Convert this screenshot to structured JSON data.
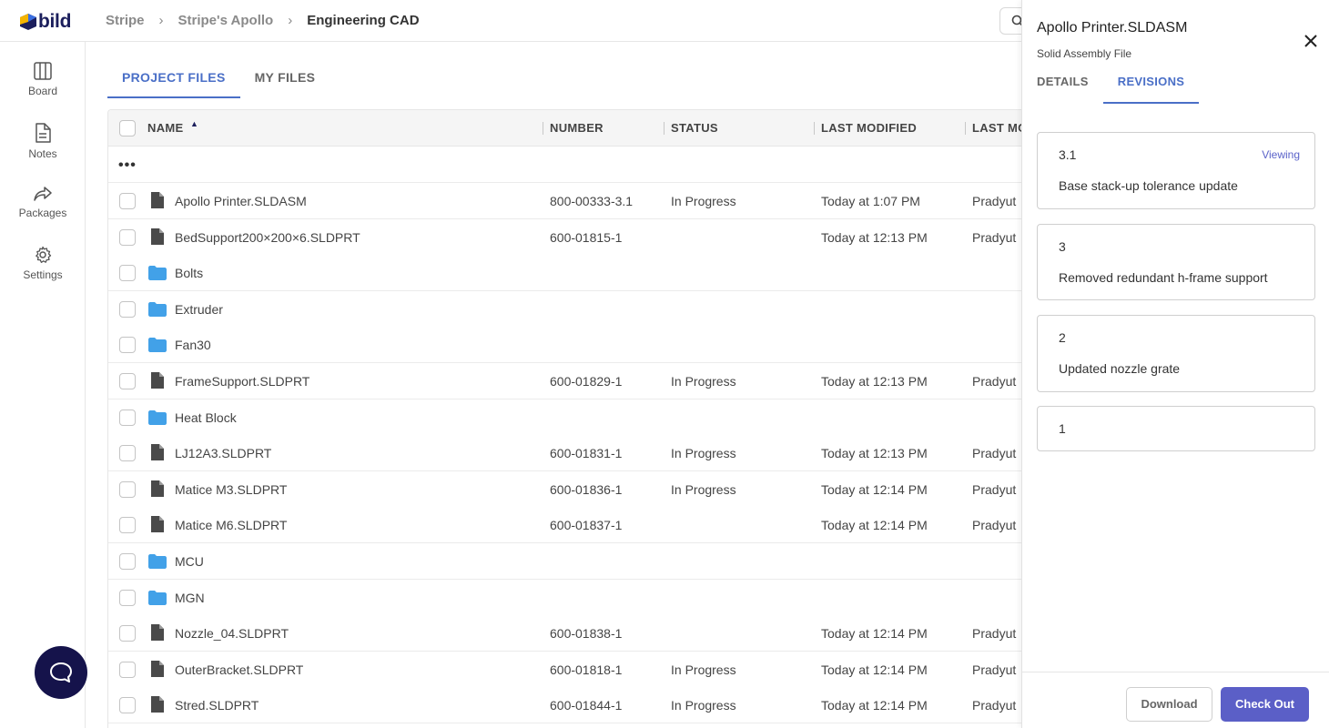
{
  "app": {
    "logo_text": "bild"
  },
  "breadcrumb": [
    "Stripe",
    "Stripe's Apollo",
    "Engineering CAD"
  ],
  "sidebar": {
    "items": [
      {
        "label": "Board",
        "icon": "board-icon"
      },
      {
        "label": "Notes",
        "icon": "notes-icon"
      },
      {
        "label": "Packages",
        "icon": "share-arrow-icon"
      },
      {
        "label": "Settings",
        "icon": "gear-icon"
      }
    ]
  },
  "main": {
    "tabs": [
      {
        "label": "PROJECT FILES",
        "active": true
      },
      {
        "label": "MY FILES",
        "active": false
      }
    ],
    "table": {
      "columns": [
        "NAME",
        "NUMBER",
        "STATUS",
        "LAST MODIFIED",
        "LAST MO"
      ],
      "sort_indicator": "▲",
      "parent_dir": "•••",
      "rows": [
        {
          "type": "file",
          "name": "Apollo Printer.SLDASM",
          "number": "800-00333-3.1",
          "status": "In Progress",
          "modified": "Today at 1:07 PM",
          "modified_by": "Pradyut"
        },
        {
          "type": "file",
          "name": "BedSupport200×200×6.SLDPRT",
          "number": "600-01815-1",
          "status": "",
          "modified": "Today at 12:13 PM",
          "modified_by": "Pradyut"
        },
        {
          "type": "folder",
          "name": "Bolts",
          "number": "",
          "status": "",
          "modified": "",
          "modified_by": ""
        },
        {
          "type": "folder",
          "name": "Extruder",
          "number": "",
          "status": "",
          "modified": "",
          "modified_by": ""
        },
        {
          "type": "folder",
          "name": "Fan30",
          "number": "",
          "status": "",
          "modified": "",
          "modified_by": ""
        },
        {
          "type": "file",
          "name": "FrameSupport.SLDPRT",
          "number": "600-01829-1",
          "status": "In Progress",
          "modified": "Today at 12:13 PM",
          "modified_by": "Pradyut"
        },
        {
          "type": "folder",
          "name": "Heat Block",
          "number": "",
          "status": "",
          "modified": "",
          "modified_by": ""
        },
        {
          "type": "file",
          "name": "LJ12A3.SLDPRT",
          "number": "600-01831-1",
          "status": "In Progress",
          "modified": "Today at 12:13 PM",
          "modified_by": "Pradyut"
        },
        {
          "type": "file",
          "name": "Matice M3.SLDPRT",
          "number": "600-01836-1",
          "status": "In Progress",
          "modified": "Today at 12:14 PM",
          "modified_by": "Pradyut"
        },
        {
          "type": "file",
          "name": "Matice M6.SLDPRT",
          "number": "600-01837-1",
          "status": "",
          "modified": "Today at 12:14 PM",
          "modified_by": "Pradyut"
        },
        {
          "type": "folder",
          "name": "MCU",
          "number": "",
          "status": "",
          "modified": "",
          "modified_by": ""
        },
        {
          "type": "folder",
          "name": "MGN",
          "number": "",
          "status": "",
          "modified": "",
          "modified_by": ""
        },
        {
          "type": "file",
          "name": "Nozzle_04.SLDPRT",
          "number": "600-01838-1",
          "status": "",
          "modified": "Today at 12:14 PM",
          "modified_by": "Pradyut"
        },
        {
          "type": "file",
          "name": "OuterBracket.SLDPRT",
          "number": "600-01818-1",
          "status": "In Progress",
          "modified": "Today at 12:14 PM",
          "modified_by": "Pradyut"
        },
        {
          "type": "file",
          "name": "Stred.SLDPRT",
          "number": "600-01844-1",
          "status": "In Progress",
          "modified": "Today at 12:14 PM",
          "modified_by": "Pradyut"
        }
      ]
    }
  },
  "panel": {
    "title": "Apollo Printer.SLDASM",
    "subtitle": "Solid Assembly File",
    "tabs": [
      {
        "label": "DETAILS",
        "active": false
      },
      {
        "label": "REVISIONS",
        "active": true
      }
    ],
    "revisions": [
      {
        "number": "3.1",
        "description": "Base stack-up tolerance update",
        "viewing": "Viewing"
      },
      {
        "number": "3",
        "description": "Removed redundant h-frame support",
        "viewing": ""
      },
      {
        "number": "2",
        "description": "Updated nozzle grate",
        "viewing": ""
      },
      {
        "number": "1",
        "description": "",
        "viewing": ""
      }
    ],
    "download_label": "Download",
    "checkout_label": "Check Out"
  },
  "colors": {
    "accent": "#4a6fc7",
    "primary_button": "#5b5fc7",
    "folder": "#42a1e8",
    "file_icon": "#4a4a4a",
    "chat_button": "#15134b",
    "logo": "#1b1e5c"
  }
}
